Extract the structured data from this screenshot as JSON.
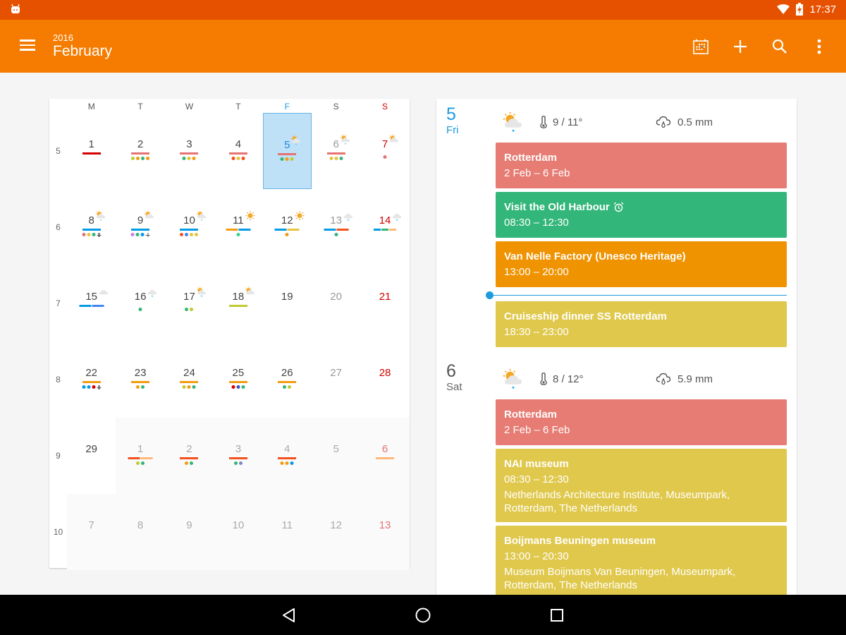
{
  "status_bar": {
    "time": "17:37"
  },
  "header": {
    "year": "2016",
    "month": "February"
  },
  "toolbar": {
    "today_label": "Go to today",
    "add_label": "Add event",
    "search_label": "Search",
    "more_label": "More options"
  },
  "calendar": {
    "days_of_week": [
      "M",
      "T",
      "W",
      "T",
      "F",
      "S",
      "S"
    ],
    "week_numbers": [
      "5",
      "6",
      "7",
      "8",
      "9",
      "10"
    ],
    "weeks": [
      [
        {
          "day": "1",
          "bars": [
            "#d50000"
          ],
          "dots": []
        },
        {
          "day": "2",
          "bars": [
            "#e57373"
          ],
          "dots": [
            "#c0ca33",
            "#f39c12",
            "#33b679",
            "#f39c12"
          ]
        },
        {
          "day": "3",
          "bars": [
            "#e57373"
          ],
          "dots": [
            "#33b679",
            "#e4c441",
            "#f39c12"
          ]
        },
        {
          "day": "4",
          "bars": [
            "#e57373"
          ],
          "dots": [
            "#f4511e",
            "#e4c441",
            "#f4511e"
          ]
        },
        {
          "day": "5",
          "weather": "partly-cloudy-rain",
          "bars": [
            "#e57373"
          ],
          "dots": [
            "#33b679",
            "#f39c12",
            "#c0ca33"
          ],
          "selected": true
        },
        {
          "day": "6",
          "weather": "partly-cloudy-rain",
          "bars": [
            "#e57373"
          ],
          "dots": [
            "#e4c441",
            "#e4c441",
            "#33b679"
          ],
          "weekend": true
        },
        {
          "day": "7",
          "weather": "partly-cloudy",
          "bars": [],
          "dots": [
            "#e57373"
          ],
          "sunday": true
        }
      ],
      [
        {
          "day": "8",
          "weather": "partly-cloudy-rain",
          "bars": [
            "#039be5"
          ],
          "dots": [
            "#e57373",
            "#e4c441",
            "#33b679",
            "plus"
          ]
        },
        {
          "day": "9",
          "weather": "partly-cloudy",
          "bars": [
            "#039be5"
          ],
          "dots": [
            "#d57aea",
            "#33b679",
            "#039be5",
            "plus"
          ]
        },
        {
          "day": "10",
          "weather": "partly-cloudy-rain",
          "bars": [
            "#039be5"
          ],
          "dots": [
            "#f4511e",
            "#4285f4",
            "#e4c441",
            "#e4c441"
          ]
        },
        {
          "day": "11",
          "weather": "sunny",
          "bars": [
            "#f39c12",
            "#039be5"
          ],
          "dots": [
            "#33d68a"
          ]
        },
        {
          "day": "12",
          "weather": "sunny",
          "bars": [
            "#039be5",
            "#e4c441"
          ],
          "dots": [
            "#f39c12"
          ]
        },
        {
          "day": "13",
          "weather": "snow",
          "bars": [
            "#039be5",
            "#f4511e"
          ],
          "dots": [
            "#33b679"
          ],
          "weekend": true
        },
        {
          "day": "14",
          "weather": "snow",
          "bars": [
            "#039be5",
            "#33b679",
            "#ffb878"
          ],
          "dots": [],
          "sunday": true
        }
      ],
      [
        {
          "day": "15",
          "weather": "cloudy",
          "bars": [
            "#039be5",
            "#4285f4"
          ],
          "dots": []
        },
        {
          "day": "16",
          "weather": "snow",
          "bars": [],
          "dots": [
            "#33b679"
          ]
        },
        {
          "day": "17",
          "weather": "partly-cloudy-snow",
          "bars": [],
          "dots": [
            "#33b679",
            "#c0ca33"
          ]
        },
        {
          "day": "18",
          "weather": "partly-cloudy",
          "bars": [
            "#c0ca33"
          ],
          "dots": []
        },
        {
          "day": "19",
          "bars": [],
          "dots": []
        },
        {
          "day": "20",
          "bars": [],
          "dots": [],
          "weekend": true
        },
        {
          "day": "21",
          "bars": [],
          "dots": [],
          "sunday": true
        }
      ],
      [
        {
          "day": "22",
          "bars": [
            "#f39c12"
          ],
          "dots": [
            "#039be5",
            "#039be5",
            "#d50000",
            "plus"
          ]
        },
        {
          "day": "23",
          "bars": [
            "#f39c12"
          ],
          "dots": [
            "#f39c12",
            "#33b679"
          ]
        },
        {
          "day": "24",
          "bars": [
            "#f39c12"
          ],
          "dots": [
            "#c0ca33",
            "#f39c12",
            "#33b679"
          ]
        },
        {
          "day": "25",
          "bars": [
            "#f39c12"
          ],
          "dots": [
            "#d50000",
            "#3f51b5",
            "#33b679"
          ]
        },
        {
          "day": "26",
          "bars": [
            "#f39c12"
          ],
          "dots": [
            "#33b679",
            "#c0ca33"
          ]
        },
        {
          "day": "27",
          "bars": [],
          "dots": [],
          "weekend": true
        },
        {
          "day": "28",
          "bars": [],
          "dots": [],
          "sunday": true
        }
      ],
      [
        {
          "day": "29",
          "bars": [],
          "dots": []
        },
        {
          "day": "1",
          "bars": [
            "#f4511e",
            "#ffb878"
          ],
          "dots": [
            "#c0ca33",
            "#33b679"
          ],
          "other": true
        },
        {
          "day": "2",
          "bars": [
            "#f4511e"
          ],
          "dots": [
            "#f39c12",
            "#33b679"
          ],
          "other": true
        },
        {
          "day": "3",
          "bars": [
            "#f4511e"
          ],
          "dots": [
            "#33b679",
            "#7986cb"
          ],
          "other": true
        },
        {
          "day": "4",
          "bars": [
            "#f4511e"
          ],
          "dots": [
            "#f39c12",
            "#f39c12",
            "#039be5"
          ],
          "other": true
        },
        {
          "day": "5",
          "bars": [],
          "dots": [],
          "other": true,
          "weekend": true
        },
        {
          "day": "6",
          "bars": [
            "#ffb878"
          ],
          "dots": [],
          "other": true,
          "sunday": true
        }
      ],
      [
        {
          "day": "7",
          "bars": [],
          "dots": [],
          "other": true
        },
        {
          "day": "8",
          "bars": [],
          "dots": [],
          "other": true
        },
        {
          "day": "9",
          "bars": [],
          "dots": [],
          "other": true
        },
        {
          "day": "10",
          "bars": [],
          "dots": [],
          "other": true
        },
        {
          "day": "11",
          "bars": [],
          "dots": [],
          "other": true
        },
        {
          "day": "12",
          "bars": [],
          "dots": [],
          "other": true,
          "weekend": true
        },
        {
          "day": "13",
          "bars": [],
          "dots": [],
          "other": true,
          "sunday": true
        }
      ]
    ]
  },
  "agenda": {
    "days": [
      {
        "day_number": "5",
        "day_name": "Fri",
        "is_today": true,
        "weather_icon": "partly-cloudy-rain",
        "temperature": "9 / 11°",
        "precipitation": "0.5 mm",
        "events": [
          {
            "title": "Rotterdam",
            "subtitle": "2 Feb – 6 Feb",
            "color": "#e67c73"
          },
          {
            "title": "Visit the Old Harbour",
            "subtitle": "08:30 – 12:30",
            "color": "#33b679",
            "alarm": true
          },
          {
            "title": "Van Nelle Factory (Unesco Heritage)",
            "subtitle": "13:00 – 20:00",
            "color": "#f09300"
          },
          {
            "title": "Cruiseship dinner SS Rotterdam",
            "subtitle": "18:30 – 23:00",
            "color": "#e0c84c"
          }
        ],
        "now_indicator_after_index": 2
      },
      {
        "day_number": "6",
        "day_name": "Sat",
        "is_today": false,
        "weather_icon": "partly-cloudy-rain",
        "temperature": "8 / 12°",
        "precipitation": "5.9 mm",
        "events": [
          {
            "title": "Rotterdam",
            "subtitle": "2 Feb – 6 Feb",
            "color": "#e67c73"
          },
          {
            "title": "NAI museum",
            "subtitle": "08:30 – 12:30",
            "location": "Netherlands Architecture Institute, Museumpark, Rotterdam, The Netherlands",
            "color": "#e0c84c"
          },
          {
            "title": "Boijmans Beuningen museum",
            "subtitle": "13:00 – 20:30",
            "location": "Museum Boijmans Van Beuningen, Museumpark, Rotterdam, The Netherlands",
            "color": "#e0c84c"
          },
          {
            "title": "",
            "subtitle": "",
            "color": "#33b679"
          }
        ]
      }
    ]
  },
  "colors": {
    "status_bar": "#e65100",
    "app_bar": "#f57c00",
    "today_accent": "#1e9be0",
    "sunday": "#d50000"
  }
}
